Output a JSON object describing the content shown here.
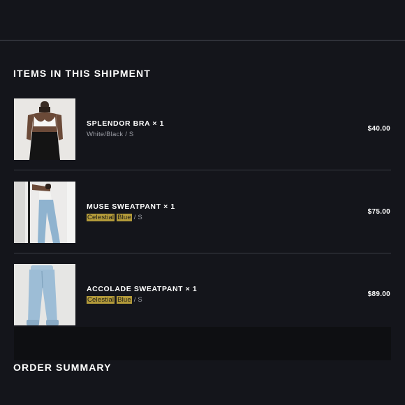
{
  "shipment": {
    "heading": "ITEMS IN THIS SHIPMENT",
    "items": [
      {
        "title": "SPLENDOR BRA × 1",
        "variant_plain": "White/Black / S",
        "price": "$40.00",
        "image": "white-bra-black-pants-photo"
      },
      {
        "title": "MUSE SWEATPANT × 1",
        "variant_hl1": "Celestial",
        "variant_hl2": "Blue",
        "variant_rest": " / S",
        "price": "$75.00",
        "image": "light-blue-sweatpant-model-photo"
      },
      {
        "title": "ACCOLADE SWEATPANT × 1",
        "variant_hl1": "Celestial",
        "variant_hl2": "Blue",
        "variant_rest": " / S",
        "price": "$89.00",
        "image": "light-blue-sweatpant-product-photo"
      }
    ]
  },
  "summary": {
    "heading": "ORDER SUMMARY"
  },
  "colors": {
    "background": "#14151b",
    "highlight": "#b39a3a"
  }
}
